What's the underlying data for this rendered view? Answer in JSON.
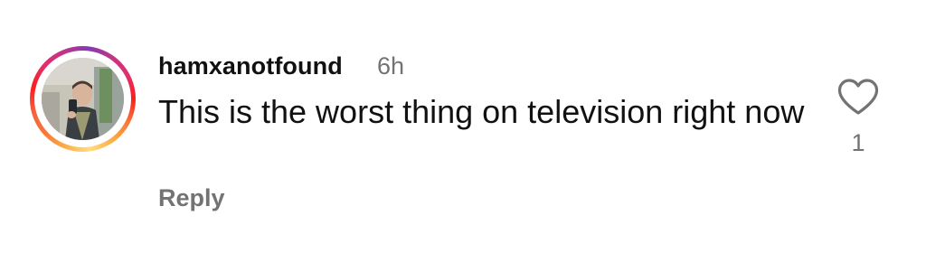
{
  "comment": {
    "username": "hamxanotfound",
    "timestamp": "6h",
    "text": "This is the worst thing on television right now",
    "reply_label": "Reply",
    "like_count": "1",
    "like_icon": "heart-outline-icon"
  },
  "colors": {
    "text": "#111111",
    "secondary_text": "#737373",
    "background": "#ffffff",
    "story_ring": [
      "#fcaf45",
      "#fd1d1d",
      "#e1306c",
      "#c13584",
      "#833ab4"
    ]
  }
}
